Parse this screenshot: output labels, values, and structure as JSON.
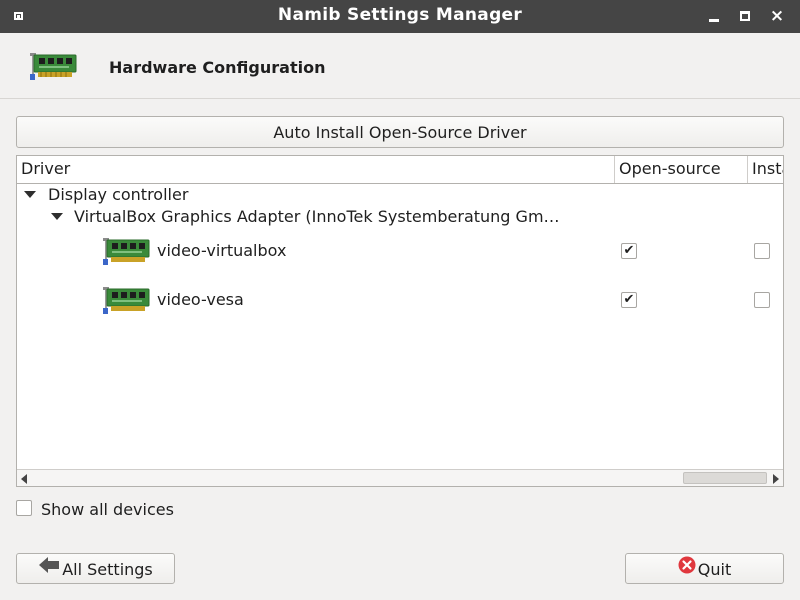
{
  "window": {
    "title": "Namib Settings Manager",
    "controls": {
      "minimize": "minimize",
      "maximize": "maximize",
      "close": "×"
    }
  },
  "header": {
    "title": "Hardware Configuration",
    "icon": "pci-card-icon"
  },
  "toolbar": {
    "auto_install_label": "Auto Install Open-Source Driver"
  },
  "tree": {
    "columns": [
      "Driver",
      "Open-source",
      "Installed"
    ],
    "groups": [
      {
        "label": "Display controller",
        "expanded": true,
        "devices": [
          {
            "label": "VirtualBox Graphics Adapter (InnoTek Systemberatung Gm…",
            "expanded": true,
            "drivers": [
              {
                "name": "video-virtualbox",
                "open_source": true,
                "installed": false
              },
              {
                "name": "video-vesa",
                "open_source": true,
                "installed": false
              }
            ]
          }
        ]
      }
    ]
  },
  "options": {
    "show_all_devices_label": "Show all devices",
    "show_all_devices": false
  },
  "footer": {
    "all_settings_label": "All Settings",
    "quit_label": "Quit"
  },
  "colors": {
    "titlebar": "#454545",
    "window_bg": "#f2f1f0",
    "quit_icon": "#e0383e",
    "back_arrow": "#555555",
    "card_green": "#3a8a3a"
  }
}
